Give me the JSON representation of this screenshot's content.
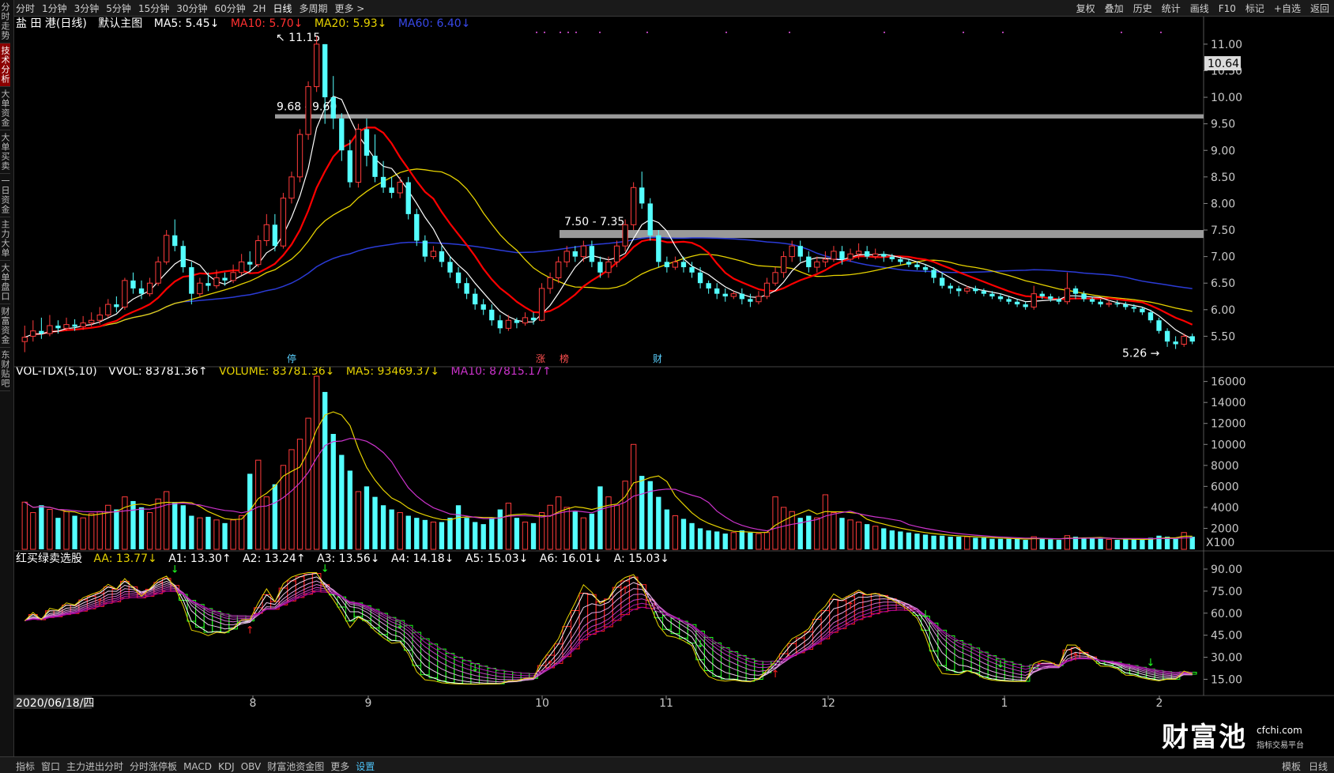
{
  "toolbar": {
    "periods": [
      "分时",
      "1分钟",
      "3分钟",
      "5分钟",
      "15分钟",
      "30分钟",
      "60分钟",
      "2H",
      "日线",
      "多周期",
      "更多 >"
    ],
    "active_period": "日线",
    "right_buttons": [
      "复权",
      "叠加",
      "历史",
      "统计",
      "画线",
      "F10",
      "标记",
      "+自选",
      "返回"
    ]
  },
  "sidebar": [
    "分时走势",
    "技术分析",
    "大单资金",
    "大单买卖",
    "一日资金",
    "主力大单",
    "大单盘口",
    "财富资金",
    "东财贴吧"
  ],
  "sidebar_active": "技术分析",
  "main_info": {
    "name": "盐 田 港(日线)",
    "template": "默认主图",
    "ma5": "MA5: 5.45↓",
    "ma10": "MA10: 5.70↓",
    "ma20": "MA20: 5.93↓",
    "ma60": "MA60: 6.40↓"
  },
  "vol_info": {
    "name": "VOL-TDX(5,10)",
    "vvol": "VVOL: 83781.36↑",
    "volume": "VOLUME: 83781.36↓",
    "ma5": "MA5: 93469.37↓",
    "ma10": "MA10: 87815.17↑"
  },
  "ind_info": {
    "name": "红买绿卖选股",
    "aa": "AA: 13.77↓",
    "a1": "A1: 13.30↑",
    "a2": "A2: 13.24↑",
    "a3": "A3: 13.56↓",
    "a4": "A4: 14.18↓",
    "a5": "A5: 15.03↓",
    "a6": "A6: 16.01↓",
    "a": "A: 15.03↓"
  },
  "bottombar": {
    "items": [
      "指标",
      "窗口",
      "主力进出分时",
      "分时涨停板",
      "MACD",
      "KDJ",
      "OBV",
      "财富池资金图",
      "更多",
      "设置"
    ],
    "highlight": "设置",
    "right": [
      "模板",
      "日线"
    ]
  },
  "watermark": {
    "brand": "财富池",
    "site": "cfchi.com",
    "sub": "指标交易平台"
  },
  "colors": {
    "up": "#ff3b3b",
    "down": "#54ffff",
    "ma5": "#ffffff",
    "ma10": "#ff0000",
    "ma20": "#e6d200",
    "ma60": "#2b3bd6",
    "vma5": "#e6d200",
    "vma10": "#cc33cc",
    "band": "#9a9a9a"
  },
  "chart_data": [
    {
      "type": "candlestick",
      "title": "盐 田 港(日线)",
      "ylim": [
        5.0,
        11.4
      ],
      "y_ticks": [
        "11.00",
        "10.50",
        "10.00",
        "9.50",
        "9.00",
        "8.50",
        "8.00",
        "7.50",
        "7.00",
        "6.50",
        "6.00",
        "5.50"
      ],
      "current_price_label": "10.64",
      "annotations": [
        "11.15",
        "9.68 - 9.60",
        "7.50 - 7.35",
        "5.26"
      ],
      "event_markers": [
        "停",
        "涨",
        "榜",
        "财"
      ],
      "x_date_label": "2020/06/18/四",
      "x_month_ticks": [
        "8",
        "9",
        "10",
        "11",
        "12",
        "1",
        "2"
      ],
      "bars": [
        [
          5.4,
          5.48,
          5.2,
          5.7,
          0
        ],
        [
          5.5,
          5.6,
          5.4,
          5.8,
          0
        ],
        [
          5.6,
          5.55,
          5.45,
          5.85,
          0
        ],
        [
          5.55,
          5.7,
          5.5,
          5.9,
          0
        ],
        [
          5.7,
          5.65,
          5.55,
          5.8,
          0
        ],
        [
          5.65,
          5.72,
          5.6,
          5.85,
          0
        ],
        [
          5.72,
          5.68,
          5.6,
          5.82,
          0
        ],
        [
          5.68,
          5.75,
          5.62,
          5.88,
          0
        ],
        [
          5.75,
          5.8,
          5.68,
          5.95,
          0
        ],
        [
          5.8,
          5.9,
          5.72,
          6.05,
          0
        ],
        [
          5.9,
          6.1,
          5.85,
          6.2,
          0
        ],
        [
          6.1,
          6.05,
          5.95,
          6.25,
          0
        ],
        [
          6.05,
          6.55,
          6.0,
          6.6,
          0
        ],
        [
          6.55,
          6.4,
          6.3,
          6.7,
          0
        ],
        [
          6.4,
          6.3,
          6.2,
          6.55,
          0
        ],
        [
          6.3,
          6.5,
          6.25,
          6.6,
          0
        ],
        [
          6.5,
          6.9,
          6.45,
          7.0,
          0
        ],
        [
          6.9,
          7.4,
          6.85,
          7.5,
          0
        ],
        [
          7.4,
          7.2,
          7.1,
          7.7,
          0
        ],
        [
          7.2,
          6.8,
          6.7,
          7.3,
          0
        ],
        [
          6.8,
          6.3,
          6.1,
          6.9,
          0
        ],
        [
          6.3,
          6.5,
          6.25,
          6.6,
          0
        ],
        [
          6.5,
          6.45,
          6.35,
          6.7,
          0
        ],
        [
          6.45,
          6.6,
          6.4,
          6.75,
          0
        ],
        [
          6.6,
          6.55,
          6.45,
          6.7,
          0
        ],
        [
          6.55,
          6.7,
          6.5,
          6.85,
          0
        ],
        [
          6.7,
          6.9,
          6.65,
          7.05,
          0
        ],
        [
          6.9,
          6.85,
          6.7,
          7.1,
          0
        ],
        [
          6.85,
          7.3,
          6.8,
          7.4,
          0
        ],
        [
          7.3,
          7.6,
          7.2,
          7.8,
          0
        ],
        [
          7.6,
          7.2,
          7.1,
          7.8,
          0
        ],
        [
          7.2,
          8.1,
          7.15,
          8.2,
          0
        ],
        [
          8.1,
          8.5,
          8.0,
          8.6,
          0
        ],
        [
          8.5,
          9.3,
          8.4,
          9.4,
          0
        ],
        [
          9.3,
          10.2,
          9.2,
          10.3,
          0
        ],
        [
          10.2,
          11.0,
          10.1,
          11.15,
          0
        ],
        [
          11.0,
          10.0,
          9.5,
          11.0,
          0
        ],
        [
          10.0,
          9.6,
          9.4,
          10.4,
          0
        ],
        [
          9.6,
          9.0,
          8.8,
          9.7,
          0
        ],
        [
          9.0,
          8.4,
          8.3,
          9.2,
          0
        ],
        [
          8.4,
          9.4,
          8.3,
          9.5,
          0
        ],
        [
          9.4,
          8.9,
          8.7,
          9.6,
          0
        ],
        [
          8.9,
          8.5,
          8.4,
          9.3,
          0
        ],
        [
          8.5,
          8.3,
          8.2,
          8.8,
          0
        ],
        [
          8.3,
          8.2,
          8.1,
          8.5,
          0
        ],
        [
          8.2,
          8.4,
          8.1,
          8.5,
          0
        ],
        [
          8.4,
          7.8,
          7.7,
          8.5,
          0
        ],
        [
          7.8,
          7.3,
          7.2,
          7.9,
          0
        ],
        [
          7.3,
          7.0,
          6.9,
          7.4,
          0
        ],
        [
          7.0,
          7.1,
          6.95,
          7.2,
          0
        ],
        [
          7.1,
          6.9,
          6.8,
          7.2,
          0
        ],
        [
          6.9,
          6.7,
          6.6,
          7.0,
          0
        ],
        [
          6.7,
          6.5,
          6.4,
          6.8,
          0
        ],
        [
          6.5,
          6.3,
          6.2,
          6.6,
          0
        ],
        [
          6.3,
          6.1,
          6.0,
          6.4,
          0
        ],
        [
          6.1,
          6.0,
          5.9,
          6.2,
          0
        ],
        [
          6.0,
          5.8,
          5.7,
          6.1,
          0
        ],
        [
          5.8,
          5.65,
          5.55,
          5.9,
          0
        ],
        [
          5.65,
          5.8,
          5.6,
          5.9,
          0
        ],
        [
          5.8,
          5.75,
          5.65,
          5.85,
          0
        ],
        [
          5.75,
          5.85,
          5.7,
          5.95,
          0
        ],
        [
          5.85,
          5.8,
          5.72,
          5.95,
          0
        ],
        [
          5.8,
          6.4,
          5.78,
          6.5,
          0
        ],
        [
          6.4,
          6.6,
          6.3,
          6.7,
          0
        ],
        [
          6.6,
          6.9,
          6.5,
          7.0,
          0
        ],
        [
          6.9,
          7.1,
          6.8,
          7.2,
          0
        ],
        [
          7.1,
          7.0,
          6.9,
          7.2,
          0
        ],
        [
          7.0,
          7.2,
          6.9,
          7.3,
          0
        ],
        [
          7.2,
          6.9,
          6.8,
          7.3,
          0
        ],
        [
          6.9,
          6.7,
          6.6,
          7.0,
          0
        ],
        [
          6.7,
          6.9,
          6.6,
          7.0,
          0
        ],
        [
          6.9,
          7.2,
          6.8,
          7.3,
          0
        ],
        [
          7.2,
          7.6,
          7.1,
          7.7,
          0
        ],
        [
          7.6,
          8.3,
          7.5,
          8.4,
          0
        ],
        [
          8.3,
          8.0,
          7.9,
          8.6,
          0
        ],
        [
          8.0,
          7.4,
          7.3,
          8.1,
          0
        ],
        [
          7.4,
          6.9,
          6.8,
          7.5,
          0
        ],
        [
          6.9,
          6.8,
          6.7,
          7.0,
          0
        ],
        [
          6.8,
          6.9,
          6.75,
          7.0,
          0
        ],
        [
          6.9,
          6.8,
          6.7,
          7.0,
          0
        ],
        [
          6.8,
          6.7,
          6.6,
          6.9,
          0
        ],
        [
          6.7,
          6.5,
          6.4,
          6.8,
          0
        ],
        [
          6.5,
          6.4,
          6.3,
          6.55,
          0
        ],
        [
          6.4,
          6.3,
          6.2,
          6.5,
          0
        ],
        [
          6.3,
          6.25,
          6.15,
          6.4,
          0
        ],
        [
          6.25,
          6.3,
          6.2,
          6.35,
          0
        ],
        [
          6.3,
          6.2,
          6.1,
          6.4,
          0
        ],
        [
          6.2,
          6.15,
          6.05,
          6.3,
          0
        ],
        [
          6.15,
          6.25,
          6.1,
          6.35,
          0
        ],
        [
          6.25,
          6.5,
          6.2,
          6.6,
          0
        ],
        [
          6.5,
          6.7,
          6.45,
          6.8,
          0
        ],
        [
          6.7,
          7.0,
          6.6,
          7.1,
          0
        ],
        [
          7.0,
          7.2,
          6.9,
          7.3,
          0
        ],
        [
          7.2,
          7.0,
          6.9,
          7.3,
          0
        ],
        [
          7.0,
          6.8,
          6.7,
          7.1,
          0
        ],
        [
          6.8,
          6.9,
          6.7,
          7.0,
          0
        ],
        [
          6.9,
          6.95,
          6.8,
          7.1,
          0
        ],
        [
          6.95,
          7.1,
          6.9,
          7.2,
          0
        ],
        [
          7.1,
          6.95,
          6.85,
          7.2,
          0
        ],
        [
          6.95,
          7.05,
          6.9,
          7.15,
          0
        ],
        [
          7.05,
          7.1,
          6.95,
          7.25,
          0
        ],
        [
          7.1,
          7.0,
          6.95,
          7.2,
          0
        ],
        [
          7.0,
          7.05,
          6.95,
          7.15,
          0
        ],
        [
          7.05,
          7.0,
          6.9,
          7.1,
          0
        ],
        [
          7.0,
          6.95,
          6.9,
          7.05,
          0
        ],
        [
          6.95,
          6.9,
          6.85,
          7.0,
          0
        ],
        [
          6.9,
          6.85,
          6.8,
          6.95,
          0
        ],
        [
          6.85,
          6.8,
          6.75,
          6.9,
          0
        ],
        [
          6.8,
          6.75,
          6.7,
          6.85,
          0
        ],
        [
          6.75,
          6.6,
          6.5,
          6.8,
          0
        ],
        [
          6.6,
          6.45,
          6.4,
          6.7,
          0
        ],
        [
          6.45,
          6.4,
          6.3,
          6.5,
          0
        ],
        [
          6.4,
          6.35,
          6.25,
          6.45,
          0
        ],
        [
          6.35,
          6.4,
          6.3,
          6.45,
          0
        ],
        [
          6.4,
          6.35,
          6.3,
          6.45,
          0
        ],
        [
          6.35,
          6.3,
          6.25,
          6.4,
          0
        ],
        [
          6.3,
          6.25,
          6.2,
          6.35,
          0
        ],
        [
          6.25,
          6.2,
          6.15,
          6.3,
          0
        ],
        [
          6.2,
          6.15,
          6.1,
          6.25,
          0
        ],
        [
          6.15,
          6.1,
          6.05,
          6.2,
          0
        ],
        [
          6.1,
          6.05,
          6.0,
          6.15,
          0
        ],
        [
          6.05,
          6.3,
          6.0,
          6.45,
          0
        ],
        [
          6.3,
          6.25,
          6.2,
          6.35,
          0
        ],
        [
          6.25,
          6.2,
          6.15,
          6.3,
          0
        ],
        [
          6.2,
          6.15,
          6.1,
          6.25,
          0
        ],
        [
          6.15,
          6.4,
          6.1,
          6.7,
          0
        ],
        [
          6.4,
          6.3,
          6.2,
          6.45,
          0
        ],
        [
          6.3,
          6.2,
          6.15,
          6.35,
          0
        ],
        [
          6.2,
          6.15,
          6.1,
          6.25,
          0
        ],
        [
          6.15,
          6.1,
          6.05,
          6.2,
          0
        ],
        [
          6.1,
          6.12,
          6.05,
          6.18,
          0
        ],
        [
          6.12,
          6.1,
          6.05,
          6.18,
          0
        ],
        [
          6.1,
          6.05,
          6.0,
          6.15,
          0
        ],
        [
          6.05,
          6.02,
          5.95,
          6.1,
          0
        ],
        [
          6.02,
          5.95,
          5.9,
          6.05,
          0
        ],
        [
          5.95,
          5.8,
          5.75,
          6.0,
          0
        ],
        [
          5.8,
          5.6,
          5.55,
          5.85,
          0
        ],
        [
          5.6,
          5.4,
          5.3,
          5.65,
          0
        ],
        [
          5.4,
          5.35,
          5.26,
          5.5,
          0
        ],
        [
          5.35,
          5.5,
          5.3,
          5.55,
          0
        ],
        [
          5.5,
          5.4,
          5.35,
          5.55,
          0
        ]
      ],
      "series": [
        {
          "name": "MA5",
          "values": [
            5.45
          ]
        },
        {
          "name": "MA10",
          "values": [
            5.7
          ]
        },
        {
          "name": "MA20",
          "values": [
            5.93
          ]
        },
        {
          "name": "MA60",
          "values": [
            6.4
          ]
        }
      ]
    },
    {
      "type": "bar",
      "title": "VOL-TDX(5,10)",
      "ylim": [
        0,
        16500
      ],
      "y_ticks": [
        "16000",
        "14000",
        "12000",
        "10000",
        "8000",
        "6000",
        "4000",
        "2000"
      ],
      "unit_label": "X100",
      "values": [
        4500,
        3500,
        4200,
        3800,
        3000,
        3600,
        3200,
        3000,
        3400,
        3600,
        4200,
        3800,
        5000,
        4600,
        4000,
        3500,
        4800,
        5500,
        4500,
        4200,
        3200,
        3000,
        3100,
        2800,
        2500,
        2800,
        3200,
        7200,
        8500,
        5000,
        6200,
        8000,
        9500,
        10500,
        12500,
        16500,
        15000,
        11000,
        9000,
        7500,
        5500,
        6000,
        5000,
        4200,
        3800,
        3500,
        3200,
        3000,
        2800,
        2600,
        2600,
        3000,
        4200,
        3000,
        2600,
        2400,
        3000,
        3800,
        4400,
        3000,
        2600,
        2500,
        3500,
        4200,
        5000,
        4000,
        3600,
        3000,
        3400,
        6000,
        5000,
        4200,
        6500,
        10000,
        7000,
        6500,
        5000,
        3800,
        3200,
        2900,
        2500,
        2000,
        1800,
        1700,
        1500,
        1600,
        1800,
        1600,
        1500,
        1600,
        5000,
        4000,
        3600,
        3000,
        3200,
        3000,
        5200,
        3500,
        3000,
        2800,
        2600,
        2400,
        2200,
        2000,
        1800,
        1700,
        1600,
        1500,
        1400,
        1300,
        1300,
        1200,
        1200,
        1200,
        1100,
        1100,
        1000,
        1000,
        1000,
        1000,
        900,
        1200,
        1000,
        950,
        900,
        1300,
        1200,
        1100,
        1050,
        1000,
        950,
        900,
        1000,
        950,
        900,
        1100,
        1300,
        1200,
        1000,
        1600,
        1200
      ]
    },
    {
      "type": "line",
      "title": "红买绿卖选股",
      "ylim": [
        5,
        97
      ],
      "y_ticks": [
        "90.00",
        "75.00",
        "60.00",
        "45.00",
        "30.00",
        "15.00"
      ],
      "series": [
        {
          "name": "AA",
          "values": [
            13.77
          ]
        },
        {
          "name": "A1",
          "values": [
            13.3
          ]
        },
        {
          "name": "A2",
          "values": [
            13.24
          ]
        },
        {
          "name": "A3",
          "values": [
            13.56
          ]
        },
        {
          "name": "A4",
          "values": [
            14.18
          ]
        },
        {
          "name": "A5",
          "values": [
            15.03
          ]
        },
        {
          "name": "A6",
          "values": [
            16.01
          ]
        },
        {
          "name": "A",
          "values": [
            15.03
          ]
        }
      ]
    }
  ]
}
